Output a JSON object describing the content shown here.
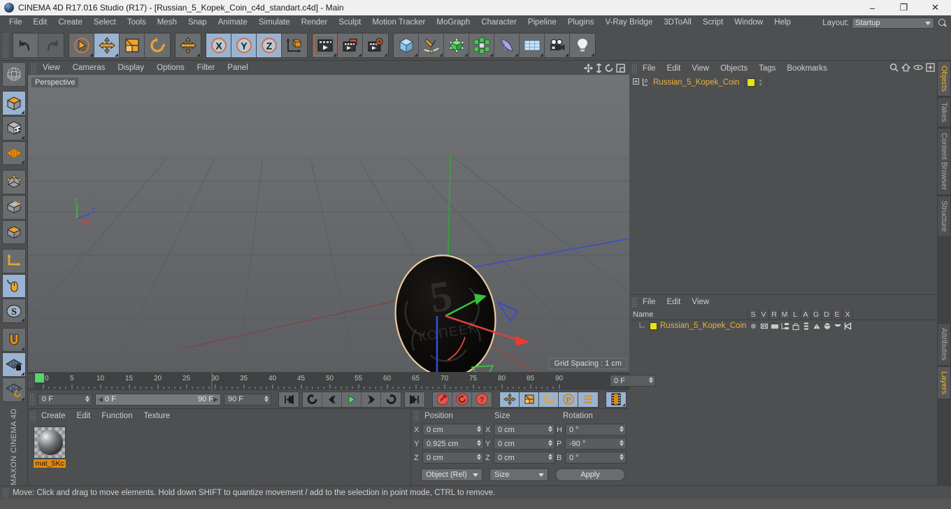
{
  "window": {
    "title": "CINEMA 4D R17.016 Studio (R17) - [Russian_5_Kopek_Coin_c4d_standart.c4d] - Main",
    "logo_icon": "cinema4d-logo-icon",
    "minimize_label": "–",
    "maximize_label": "❐",
    "close_label": "✕"
  },
  "menubar": {
    "items": [
      {
        "label": "File"
      },
      {
        "label": "Edit"
      },
      {
        "label": "Create"
      },
      {
        "label": "Select"
      },
      {
        "label": "Tools"
      },
      {
        "label": "Mesh"
      },
      {
        "label": "Snap"
      },
      {
        "label": "Animate"
      },
      {
        "label": "Simulate"
      },
      {
        "label": "Render"
      },
      {
        "label": "Sculpt"
      },
      {
        "label": "Motion Tracker"
      },
      {
        "label": "MoGraph"
      },
      {
        "label": "Character"
      },
      {
        "label": "Pipeline"
      },
      {
        "label": "Plugins"
      },
      {
        "label": "V-Ray Bridge"
      },
      {
        "label": "3DToAll"
      },
      {
        "label": "Script"
      },
      {
        "label": "Window"
      },
      {
        "label": "Help"
      }
    ],
    "layout_label": "Layout:",
    "layout_value": "Startup",
    "search_icon": "search-icon"
  },
  "toolbar": {
    "groups": [
      {
        "buttons": [
          {
            "name": "undo-button",
            "icon": "undo-icon",
            "active": false
          },
          {
            "name": "redo-button",
            "icon": "redo-icon",
            "active": false
          }
        ]
      },
      {
        "buttons": [
          {
            "name": "live-selection-tool",
            "icon": "cursor-select-icon",
            "active": false
          },
          {
            "name": "move-tool",
            "icon": "move-icon",
            "active": true
          },
          {
            "name": "scale-tool",
            "icon": "scale-icon",
            "active": false
          },
          {
            "name": "rotate-tool",
            "icon": "rotate-icon",
            "active": false
          }
        ]
      },
      {
        "buttons": [
          {
            "name": "transform-tool",
            "icon": "move-all-icon",
            "active": false
          }
        ]
      },
      {
        "buttons": [
          {
            "name": "x-axis-lock",
            "icon": "axis-x-icon",
            "active": true
          },
          {
            "name": "y-axis-lock",
            "icon": "axis-y-icon",
            "active": true
          },
          {
            "name": "z-axis-lock",
            "icon": "axis-z-icon",
            "active": true
          },
          {
            "name": "world-object-coordinates",
            "icon": "coordinate-system-icon",
            "active": false
          }
        ]
      },
      {
        "buttons": [
          {
            "name": "render-view-button",
            "icon": "render-view-icon",
            "active": false
          },
          {
            "name": "render-to-picture-viewer-button",
            "icon": "render-picture-viewer-icon",
            "active": false
          },
          {
            "name": "render-settings-button",
            "icon": "render-settings-icon",
            "active": false
          }
        ]
      },
      {
        "buttons": [
          {
            "name": "add-cube-button",
            "icon": "cube-icon",
            "active": false
          },
          {
            "name": "add-spline-button",
            "icon": "spline-pen-icon",
            "active": false
          },
          {
            "name": "add-generator-button",
            "icon": "generator-cube-icon",
            "active": false
          },
          {
            "name": "add-mograph-button",
            "icon": "mograph-cluster-icon",
            "active": false
          },
          {
            "name": "add-deformer-button",
            "icon": "bend-deformer-icon",
            "active": false
          },
          {
            "name": "add-environment-button",
            "icon": "environment-grid-icon",
            "active": false
          },
          {
            "name": "add-camera-button",
            "icon": "camera-icon",
            "active": false
          },
          {
            "name": "add-light-button",
            "icon": "light-bulb-icon",
            "active": false
          }
        ]
      }
    ]
  },
  "leftrail": {
    "items": [
      {
        "name": "rail-make-editable",
        "icon": "globe-wire-icon",
        "active": false
      },
      {
        "name": "rail-model-mode",
        "icon": "cube-orange-icon",
        "active": true
      },
      {
        "name": "rail-texture-mode",
        "icon": "texture-cube-icon",
        "active": false
      },
      {
        "name": "rail-workplane-mode",
        "icon": "polygon-grid-icon",
        "active": false
      },
      {
        "name": "rail-points-mode",
        "icon": "points-cube-icon",
        "active": false
      },
      {
        "name": "rail-edges-mode",
        "icon": "edges-cube-icon",
        "active": false
      },
      {
        "name": "rail-polygons-mode",
        "icon": "polygons-cube-icon",
        "active": false
      },
      {
        "name": "rail-axis-mode",
        "icon": "axis-arrows-icon",
        "active": false
      },
      {
        "name": "rail-viewport-solo",
        "icon": "mouse-icon",
        "active": true
      },
      {
        "name": "rail-scale-mode",
        "icon": "s-circle-icon",
        "active": false
      },
      {
        "name": "rail-snap-enable",
        "icon": "magnet-icon",
        "active": false
      },
      {
        "name": "rail-lock-workplane",
        "icon": "grid-lock-icon",
        "active": true
      },
      {
        "name": "rail-align-workplane",
        "icon": "grid-rotate-icon",
        "active": false
      }
    ],
    "brand_line1": "MAXON",
    "brand_line2": "CINEMA 4D"
  },
  "viewport": {
    "menus": [
      {
        "label": "View"
      },
      {
        "label": "Cameras"
      },
      {
        "label": "Display"
      },
      {
        "label": "Options"
      },
      {
        "label": "Filter"
      },
      {
        "label": "Panel"
      }
    ],
    "nav_icons": [
      {
        "name": "viewport-pan-icon",
        "icon": "pan-icon"
      },
      {
        "name": "viewport-zoom-icon",
        "icon": "zoom-arrow-icon"
      },
      {
        "name": "viewport-rotate-icon",
        "icon": "rotate-view-icon"
      },
      {
        "name": "viewport-maximize-icon",
        "icon": "maximize-panel-icon"
      }
    ],
    "perspective_label": "Perspective",
    "grid_spacing_label": "Grid Spacing : 1 cm",
    "axis_labels": {
      "x": "X",
      "y": "Y",
      "z": "Z"
    },
    "object_face_text_value": "5",
    "object_face_text_denom": "КОПЕЕК",
    "colors": {
      "x_axis": "#d94040",
      "y_axis": "#36c23b",
      "z_axis": "#3a49d6",
      "selection_outline": "#e8c9a0"
    }
  },
  "timeline": {
    "ticks": [
      "0",
      "5",
      "10",
      "15",
      "20",
      "25",
      "30",
      "35",
      "40",
      "45",
      "50",
      "55",
      "60",
      "65",
      "70",
      "75",
      "80",
      "85",
      "90"
    ],
    "playhead_frame": 0,
    "current_frame_field": "0 F",
    "range_start": "0 F",
    "range_end": "90 F",
    "end_frame_field": "90 F",
    "right_frame_field": "0 F",
    "playback_buttons": [
      {
        "name": "go-to-start-button",
        "icon": "skip-start-icon"
      },
      {
        "name": "go-to-previous-key-button",
        "icon": "prev-key-icon"
      },
      {
        "name": "play-backwards-button",
        "icon": "play-backward-icon"
      },
      {
        "name": "play-forwards-button",
        "icon": "play-forward-icon"
      },
      {
        "name": "go-to-next-key-button",
        "icon": "next-key-icon"
      },
      {
        "name": "loop-button",
        "icon": "loop-icon"
      },
      {
        "name": "go-to-end-button",
        "icon": "skip-end-icon"
      }
    ],
    "record_buttons": [
      {
        "name": "record-active-objects-button",
        "icon": "record-key-icon"
      },
      {
        "name": "autokeying-button",
        "icon": "autokey-icon"
      },
      {
        "name": "keyframe-selection-button",
        "icon": "key-question-icon"
      }
    ],
    "key_toggle_buttons": [
      {
        "name": "key-position-button",
        "icon": "move-icon",
        "active": true
      },
      {
        "name": "key-scale-button",
        "icon": "scale-icon",
        "active": true
      },
      {
        "name": "key-rotation-button",
        "icon": "rotate-icon",
        "active": true
      },
      {
        "name": "key-parameter-button",
        "icon": "p-circle-icon",
        "active": true
      },
      {
        "name": "key-pla-button",
        "icon": "point-level-animation-icon",
        "active": true
      }
    ],
    "dope_sheet_button": {
      "name": "timeline-filmstrip-button",
      "icon": "filmstrip-icon",
      "active": true
    }
  },
  "material_manager": {
    "menus": [
      {
        "label": "Create"
      },
      {
        "label": "Edit"
      },
      {
        "label": "Function"
      },
      {
        "label": "Texture"
      }
    ],
    "materials": [
      {
        "name": "mat_5Kc",
        "selected": true,
        "swatch_icon": "material-sphere-icon"
      }
    ]
  },
  "coordinates": {
    "columns": [
      "Position",
      "Size",
      "Rotation"
    ],
    "rows": [
      {
        "pos_label": "X",
        "pos_value": "0 cm",
        "size_label": "X",
        "size_value": "0 cm",
        "rot_label": "H",
        "rot_value": "0 °"
      },
      {
        "pos_label": "Y",
        "pos_value": "0.925 cm",
        "size_label": "Y",
        "size_value": "0 cm",
        "rot_label": "P",
        "rot_value": "-90 °"
      },
      {
        "pos_label": "Z",
        "pos_value": "0 cm",
        "size_label": "Z",
        "size_value": "0 cm",
        "rot_label": "B",
        "rot_value": "0 °"
      }
    ],
    "mode_dropdown": "Object (Rel)",
    "size_dropdown": "Size",
    "apply_button": "Apply"
  },
  "object_manager": {
    "menus": [
      {
        "label": "File"
      },
      {
        "label": "Edit"
      },
      {
        "label": "View"
      },
      {
        "label": "Objects"
      },
      {
        "label": "Tags"
      },
      {
        "label": "Bookmarks"
      }
    ],
    "header_icons": [
      {
        "name": "object-search-icon",
        "icon": "search-icon"
      },
      {
        "name": "object-home-icon",
        "icon": "home-icon"
      },
      {
        "name": "object-visibility-icon",
        "icon": "eye-icon"
      },
      {
        "name": "object-new-layer-icon",
        "icon": "plus-box-icon"
      }
    ],
    "rows": [
      {
        "name": "Russian_5_Kopek_Coin",
        "layer_badge": "0",
        "expand_icon": "expand-plus-icon",
        "tag_color": "#e8e311"
      }
    ]
  },
  "layer_manager": {
    "menus": [
      {
        "label": "File"
      },
      {
        "label": "Edit"
      },
      {
        "label": "View"
      }
    ],
    "columns": [
      "Name",
      "S",
      "V",
      "R",
      "M",
      "L",
      "A",
      "G",
      "D",
      "E",
      "X"
    ],
    "rows": [
      {
        "name": "Russian_5_Kopek_Coin",
        "swatch": "#e8e311",
        "cells": [
          "solo-dot-icon",
          "visible-eye-icon",
          "render-clapper-icon",
          "manager-icon",
          "lock-icon",
          "animation-icon",
          "generator-icon",
          "deformer-icon",
          "expression-icon",
          "xref-icon"
        ]
      }
    ]
  },
  "right_tabs_top": [
    {
      "label": "Objects",
      "active": true
    },
    {
      "label": "Takes",
      "active": false
    },
    {
      "label": "Content Browser",
      "active": false
    },
    {
      "label": "Structure",
      "active": false
    }
  ],
  "right_tabs_bottom": [
    {
      "label": "Attributes",
      "active": false
    },
    {
      "label": "Layers",
      "active": true
    }
  ],
  "statusbar": {
    "text": "Move: Click and drag to move elements. Hold down SHIFT to quantize movement / add to the selection in point mode, CTRL to remove."
  }
}
